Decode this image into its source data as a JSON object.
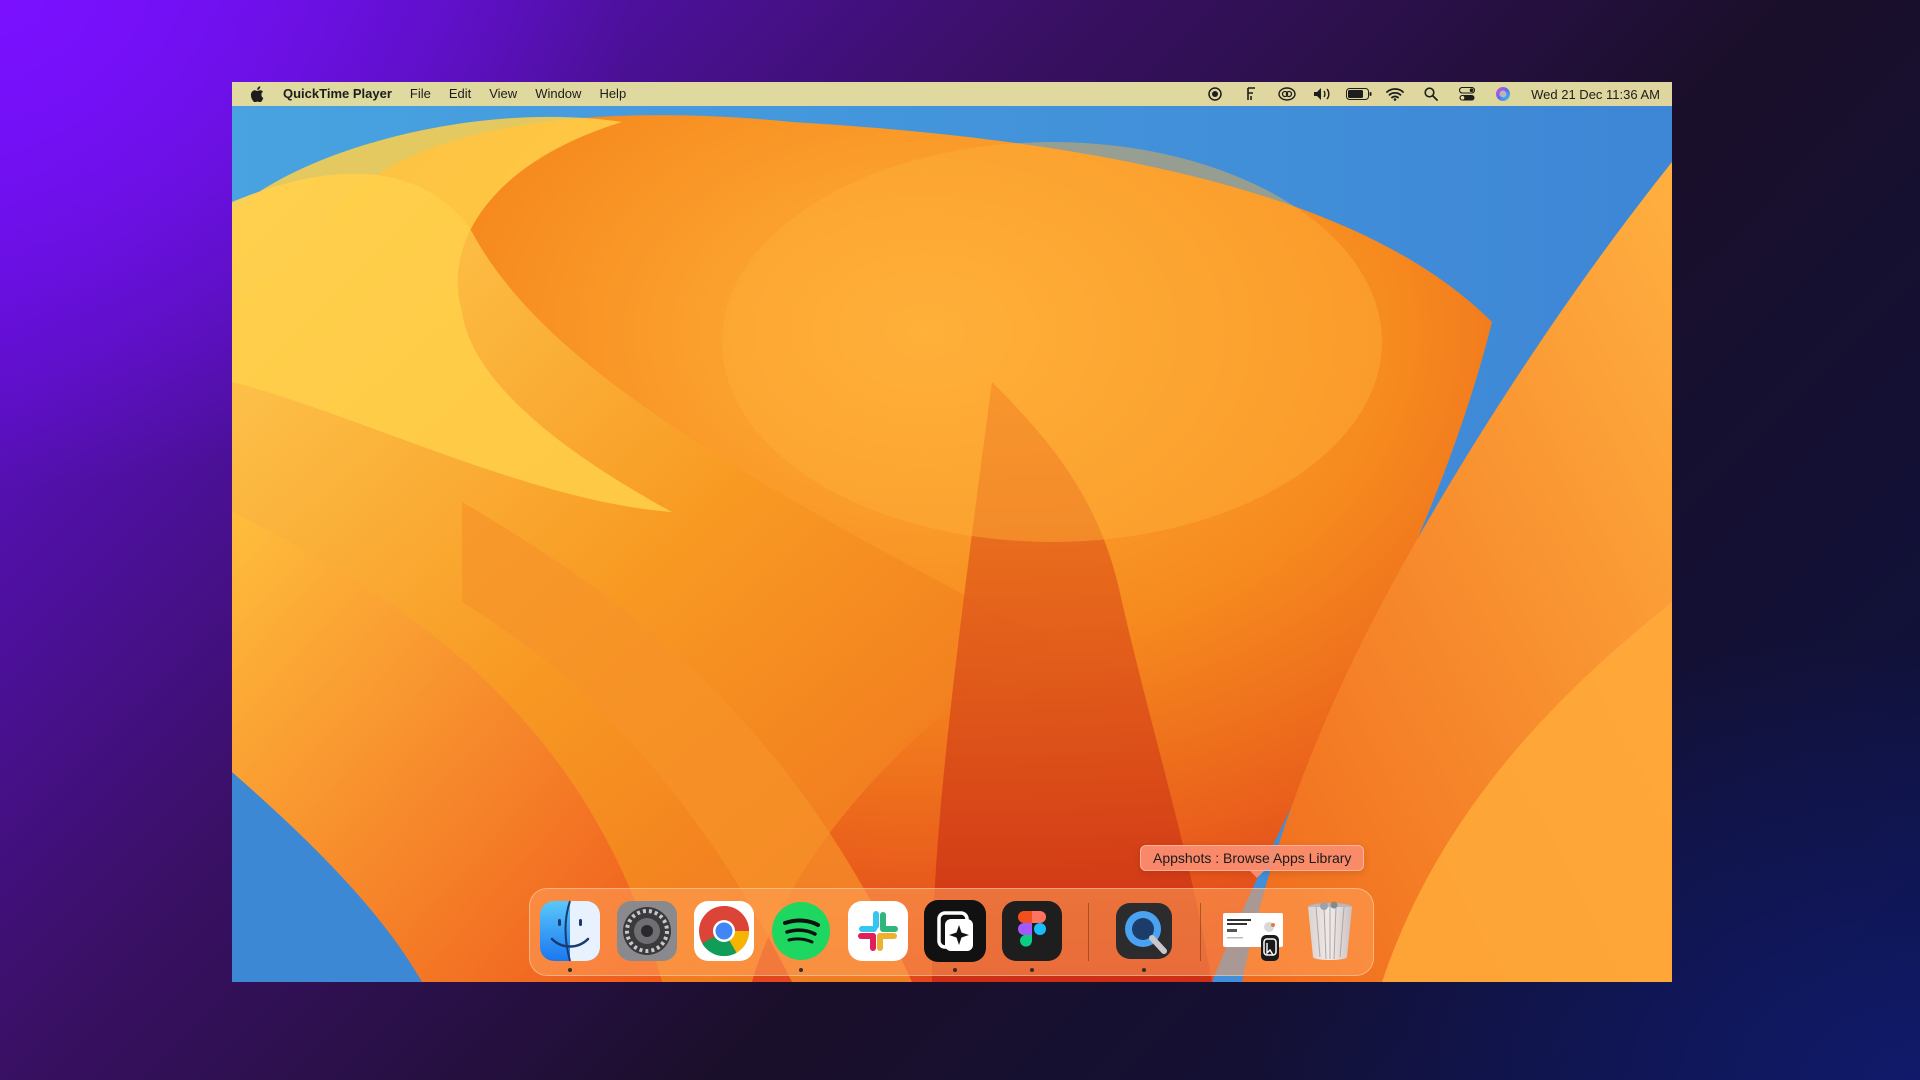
{
  "menubar": {
    "app_name": "QuickTime Player",
    "menus": [
      "File",
      "Edit",
      "View",
      "Window",
      "Help"
    ],
    "status_icons": [
      "record-icon",
      "f-icon",
      "creative-cloud-icon",
      "volume-icon",
      "battery-icon",
      "wifi-icon",
      "search-icon",
      "control-center-icon",
      "siri-icon"
    ],
    "clock": "Wed 21 Dec  11:36 AM"
  },
  "dock": {
    "apps": [
      {
        "name": "finder",
        "running": true
      },
      {
        "name": "system-settings",
        "running": false
      },
      {
        "name": "chrome",
        "running": false
      },
      {
        "name": "spotify",
        "running": true
      },
      {
        "name": "slack",
        "running": false
      },
      {
        "name": "appshots",
        "running": true
      },
      {
        "name": "figma",
        "running": true
      },
      {
        "name": "quicktime",
        "running": true
      },
      {
        "name": "document-stack",
        "running": false
      },
      {
        "name": "trash",
        "running": false
      }
    ],
    "tooltip": "Appshots : Browse Apps Library"
  },
  "colors": {
    "wallpaper_orange": "#f5a02a",
    "wallpaper_red": "#d8341a",
    "wallpaper_blue": "#3f8fd8",
    "menubar_bg": "#f5e196"
  }
}
